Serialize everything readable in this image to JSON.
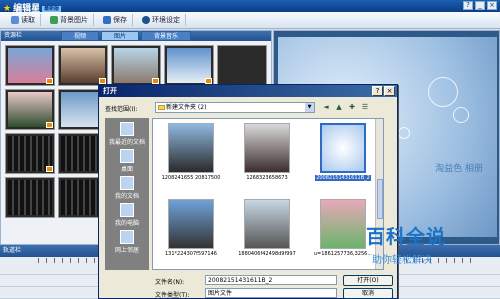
{
  "app": {
    "title": "编辑星",
    "badge": "最新版",
    "window_buttons": [
      "?",
      "_",
      "×"
    ]
  },
  "toolbar": {
    "items": [
      {
        "label": "读取",
        "icon": "open-icon",
        "color": "#5b8dd6"
      },
      {
        "label": "背景图片",
        "icon": "picture-icon",
        "color": "#3f9e4f"
      },
      {
        "label": "保存",
        "icon": "save-icon",
        "color": "#2f6fc4"
      },
      {
        "label": "环境设定",
        "icon": "gear-icon",
        "color": "#1d4f91"
      }
    ]
  },
  "left_panel": {
    "header": "资源栏",
    "tabs": [
      "视频",
      "图片",
      "背景音乐"
    ],
    "active_tab": "图片"
  },
  "track": {
    "header": "轨道栏"
  },
  "dialog": {
    "title": "打开",
    "look_in_label": "查找范围(I):",
    "look_in_value": "新建文件夹 (2)",
    "places": [
      "我最近的文档",
      "桌面",
      "我的文档",
      "我的电脑",
      "网上邻居"
    ],
    "files": [
      {
        "name": "1208241655 20817500",
        "selected": false,
        "color": "#8fb8e0"
      },
      {
        "name": "1268323658673",
        "selected": false,
        "color": "#d9d9d9"
      },
      {
        "name": "20082151431611B_2",
        "selected": true,
        "color": "#a8c8ee"
      },
      {
        "name": "131*224307f597146",
        "selected": false,
        "color": "#6fa2d8"
      },
      {
        "name": "1880406f42498d9f997",
        "selected": false,
        "color": "#c8d7e3"
      },
      {
        "name": "u=1861257736,3256...",
        "selected": false,
        "color": "#e7a9b8"
      }
    ],
    "filename_label": "文件名(N):",
    "filename_value": "20082151431611B_2",
    "filetype_label": "文件类型(T):",
    "filetype_value": "图片文件",
    "open_button": "打开(O)",
    "cancel_button": "取消"
  },
  "preview": {
    "caption": "淘益色 相册"
  },
  "watermark": {
    "main": "百科全说",
    "sub": "助你轻松解决"
  }
}
